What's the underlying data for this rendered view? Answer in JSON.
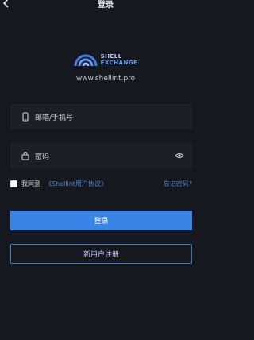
{
  "header": {
    "title": "登录",
    "back_icon": "chevron-left-icon"
  },
  "logo": {
    "line1": "SHELL",
    "line2": "EXCHANGE",
    "website": "www.shellint.pro"
  },
  "form": {
    "account_placeholder": "邮箱/手机号",
    "password_placeholder": "密码",
    "agree_text": "我同意",
    "protocol_link": "《Shellint用户协议》",
    "forgot_password": "忘记密码?",
    "login_button": "登录",
    "register_button": "新用户注册"
  },
  "colors": {
    "accent": "#3a84e6",
    "link": "#4f86d8",
    "background": "#16181f"
  }
}
